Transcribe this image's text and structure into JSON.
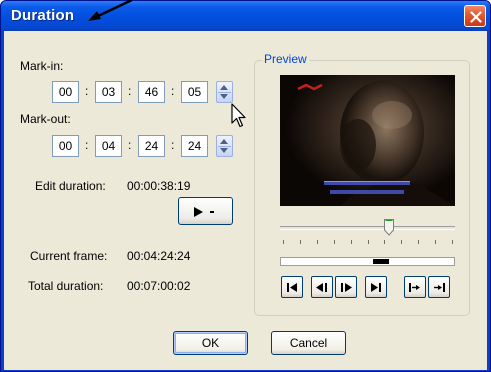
{
  "window": {
    "title": "Duration",
    "colors": {
      "titlebar": "#0450e0",
      "face": "#ece9d8",
      "close": "#e2582f",
      "group_title": "#0046d5"
    }
  },
  "mark_in": {
    "label": "Mark-in:",
    "fields": [
      "00",
      "03",
      "46",
      "05"
    ]
  },
  "mark_out": {
    "label": "Mark-out:",
    "fields": [
      "00",
      "04",
      "24",
      "24"
    ]
  },
  "edit_duration": {
    "label": "Edit duration:",
    "value": "00:00:38:19"
  },
  "current_frame": {
    "label": "Current frame:",
    "value": "00:04:24:24"
  },
  "total_duration": {
    "label": "Total duration:",
    "value": "00:07:00:02"
  },
  "preview": {
    "label": "Preview",
    "slider_position_fraction": 0.62,
    "range_mark": {
      "start_fraction": 0.53,
      "end_fraction": 0.62
    }
  },
  "transport": [
    "go-to-start-icon",
    "previous-frame-icon",
    "next-frame-icon",
    "go-to-end-icon",
    "go-to-mark-in-icon",
    "go-to-mark-out-icon"
  ],
  "buttons": {
    "ok": "OK",
    "cancel": "Cancel"
  }
}
